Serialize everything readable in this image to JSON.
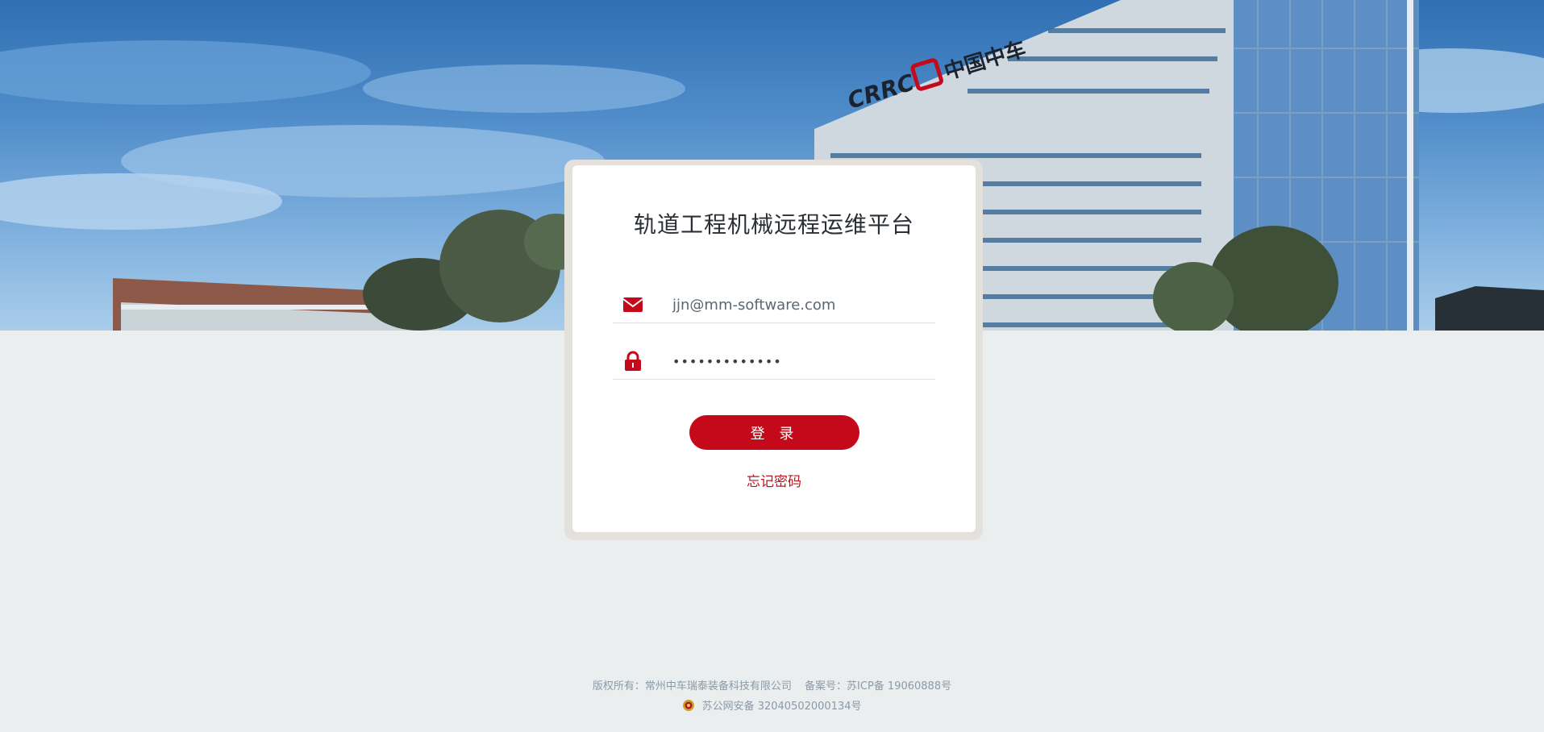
{
  "hero": {
    "logo_text": "CRRC",
    "logo_cn": "中国中车"
  },
  "login": {
    "title": "轨道工程机械远程运维平台",
    "email_value": "jjn@mm-software.com",
    "email_placeholder": "",
    "password_value": "•••••••••••••",
    "login_button": "登 录",
    "forgot_password": "忘记密码"
  },
  "icons": {
    "email": "envelope-icon",
    "password": "lock-icon",
    "police": "police-badge-icon"
  },
  "colors": {
    "accent": "#c40a1a",
    "page_bg": "#ebeeef",
    "footer_text": "#8a9aa6"
  },
  "footer": {
    "copyright": "版权所有：常州中车瑞泰装备科技有限公司",
    "icp": "备案号：苏ICP备 19060888号",
    "police_record": "苏公网安备 32040502000134号"
  }
}
